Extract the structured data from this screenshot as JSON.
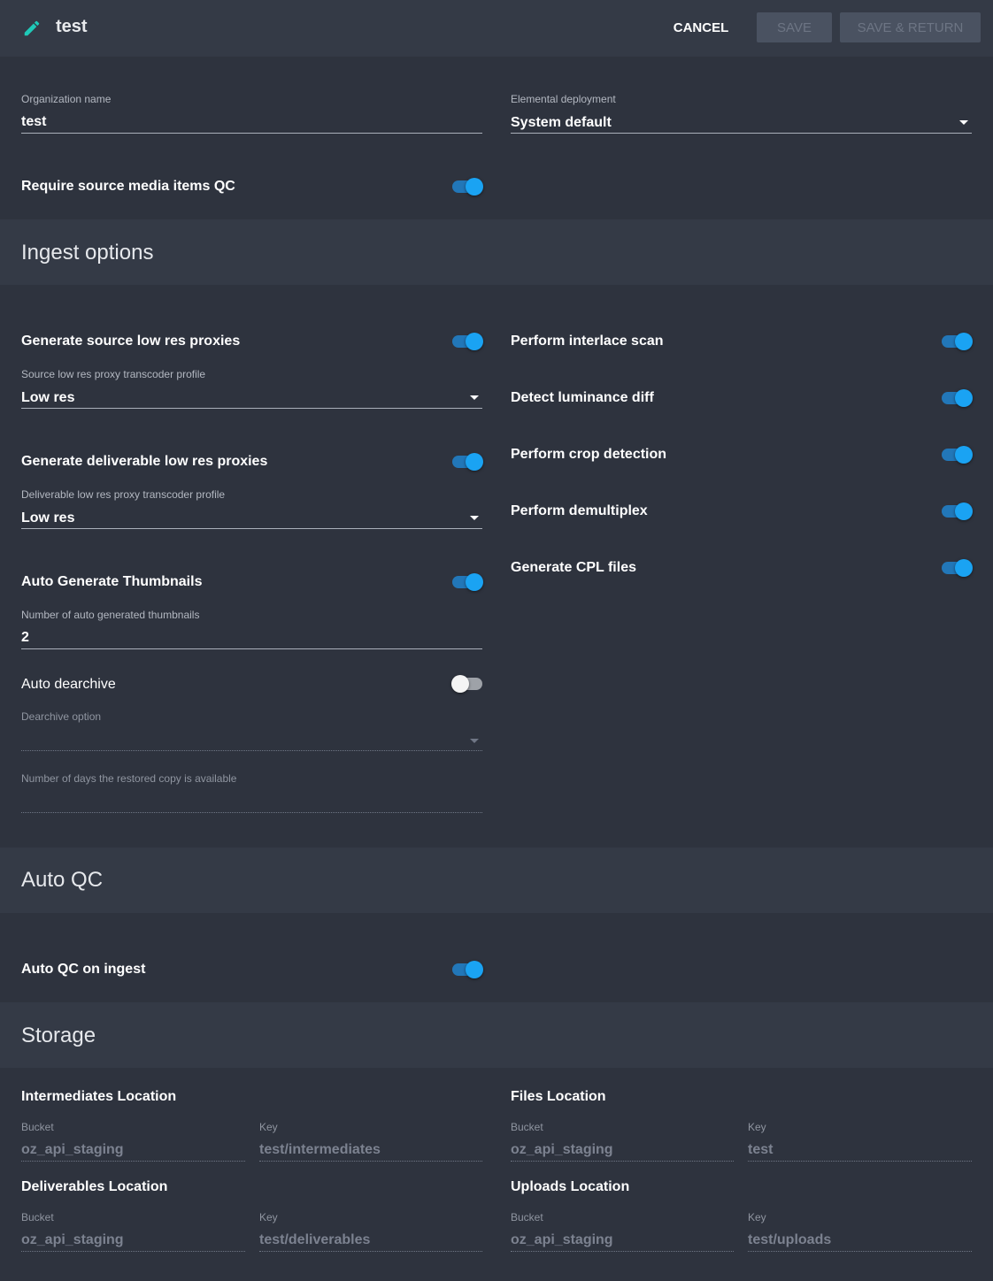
{
  "header": {
    "title": "test",
    "cancel_label": "CANCEL",
    "save_label": "SAVE",
    "save_return_label": "SAVE & RETURN"
  },
  "general": {
    "org_name_label": "Organization name",
    "org_name_value": "test",
    "elemental_label": "Elemental deployment",
    "elemental_value": "System default",
    "require_qc_label": "Require source media items QC",
    "require_qc_on": true
  },
  "ingest": {
    "title": "Ingest options",
    "gen_source_label": "Generate source low res proxies",
    "source_profile_label": "Source low res proxy transcoder profile",
    "source_profile_value": "Low res",
    "gen_deliverable_label": "Generate deliverable low res proxies",
    "deliverable_profile_label": "Deliverable low res proxy transcoder profile",
    "deliverable_profile_value": "Low res",
    "auto_thumbs_label": "Auto Generate Thumbnails",
    "num_thumbs_label": "Number of auto generated thumbnails",
    "num_thumbs_value": "2",
    "auto_dearchive_label": "Auto dearchive",
    "dearchive_option_label": "Dearchive option",
    "restored_days_label": "Number of days the restored copy is available",
    "interlace_label": "Perform interlace scan",
    "luminance_label": "Detect luminance diff",
    "crop_label": "Perform crop detection",
    "demux_label": "Perform demultiplex",
    "cpl_label": "Generate CPL files"
  },
  "autoqc": {
    "title": "Auto QC",
    "on_ingest_label": "Auto QC on ingest"
  },
  "storage": {
    "title": "Storage",
    "intermediates": {
      "title": "Intermediates Location",
      "bucket_label": "Bucket",
      "bucket": "oz_api_staging",
      "key_label": "Key",
      "key": "test/intermediates"
    },
    "files": {
      "title": "Files Location",
      "bucket_label": "Bucket",
      "bucket": "oz_api_staging",
      "key_label": "Key",
      "key": "test"
    },
    "deliverables": {
      "title": "Deliverables Location",
      "bucket_label": "Bucket",
      "bucket": "oz_api_staging",
      "key_label": "Key",
      "key": "test/deliverables"
    },
    "uploads": {
      "title": "Uploads Location",
      "bucket_label": "Bucket",
      "bucket": "oz_api_staging",
      "key_label": "Key",
      "key": "test/uploads"
    }
  },
  "colors": {
    "background": "#2e333e",
    "band": "#343a46",
    "toggle_on_thumb": "#1aa3f3",
    "toggle_on_track": "#2277b8",
    "accent_icon": "#1fc9b8"
  },
  "icons": {
    "title_icon": "pencil-icon",
    "select_icon": "caret-down-icon"
  }
}
